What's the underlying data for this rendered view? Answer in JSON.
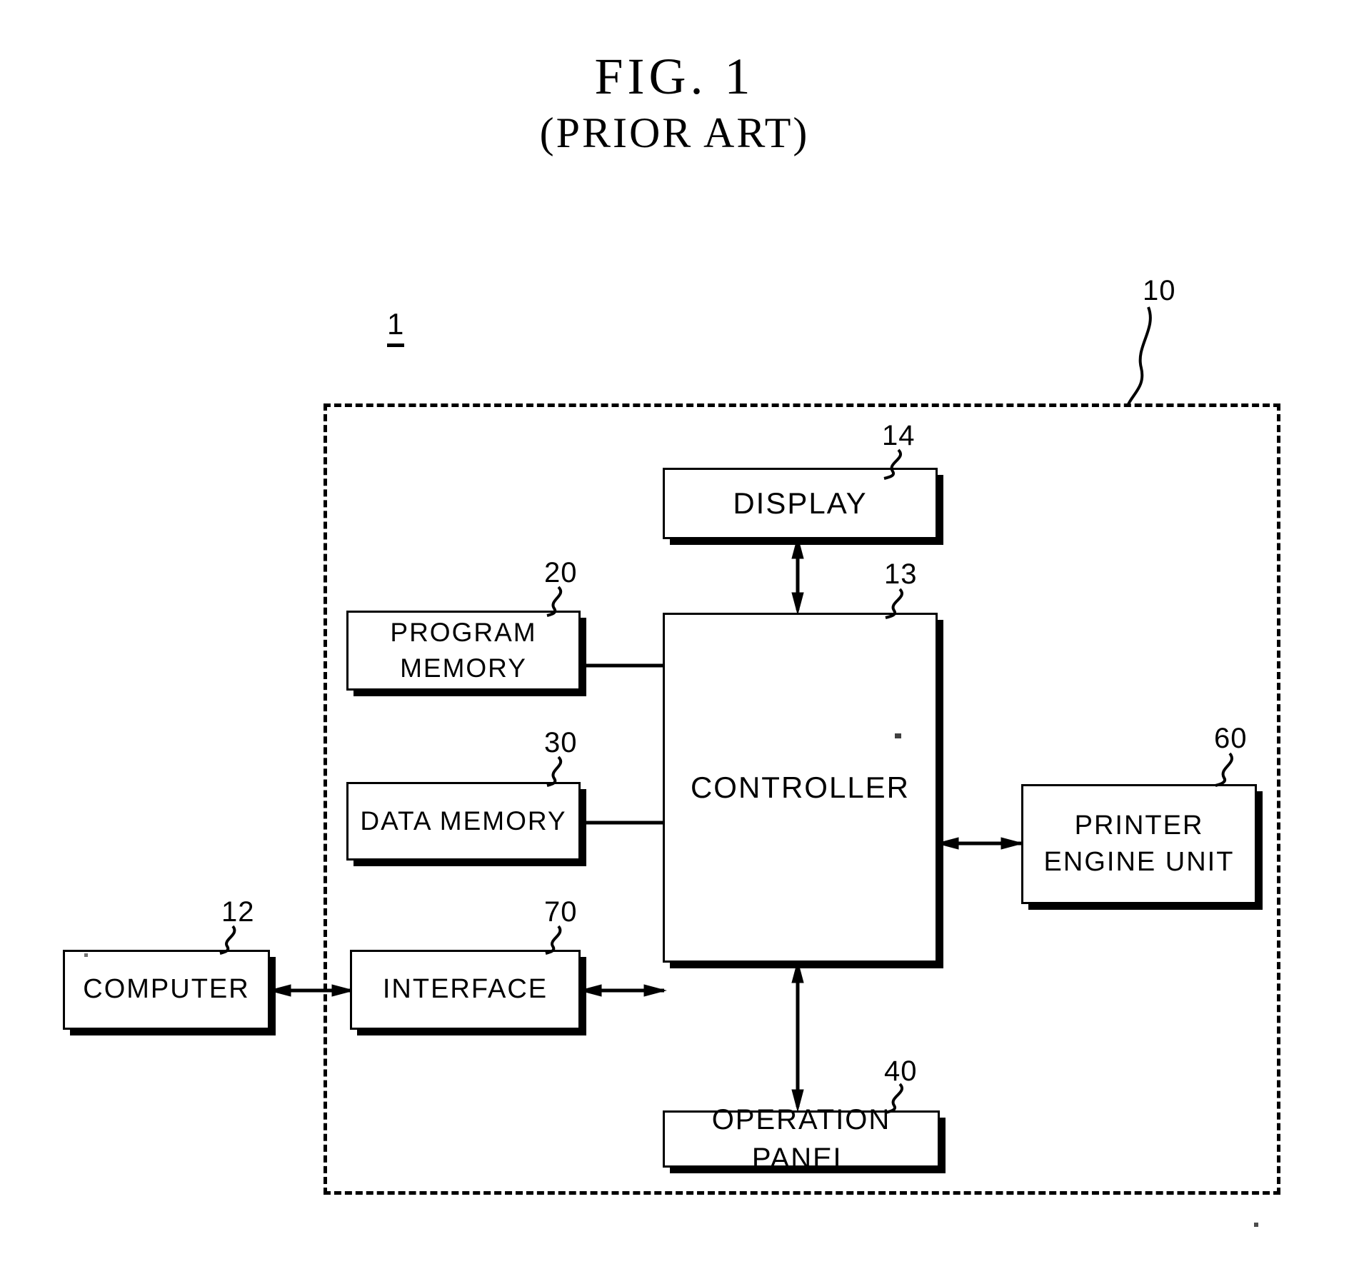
{
  "figure": {
    "title_line1": "FIG.  1",
    "title_line2": "(PRIOR ART)",
    "system_ref": "1"
  },
  "enclosure": {
    "ref": "10",
    "name": "printer-device-boundary"
  },
  "nodes": [
    {
      "id": "display",
      "label": "DISPLAY",
      "ref": "14"
    },
    {
      "id": "program_memory",
      "label": "PROGRAM\nMEMORY",
      "ref": "20"
    },
    {
      "id": "controller",
      "label": "CONTROLLER",
      "ref": "13"
    },
    {
      "id": "data_memory",
      "label": "DATA MEMORY",
      "ref": "30"
    },
    {
      "id": "printer_engine",
      "label": "PRINTER\nENGINE UNIT",
      "ref": "60"
    },
    {
      "id": "computer",
      "label": "COMPUTER",
      "ref": "12"
    },
    {
      "id": "interface",
      "label": "INTERFACE",
      "ref": "70"
    },
    {
      "id": "operation_panel",
      "label": "OPERATION PANEL",
      "ref": "40"
    }
  ],
  "connections": [
    {
      "from": "display",
      "to": "controller",
      "arrows": "both"
    },
    {
      "from": "program_memory",
      "to": "controller",
      "arrows": "none"
    },
    {
      "from": "data_memory",
      "to": "controller",
      "arrows": "none"
    },
    {
      "from": "interface",
      "to": "controller",
      "arrows": "both"
    },
    {
      "from": "computer",
      "to": "interface",
      "arrows": "both"
    },
    {
      "from": "controller",
      "to": "printer_engine",
      "arrows": "both"
    },
    {
      "from": "controller",
      "to": "operation_panel",
      "arrows": "both"
    }
  ],
  "colors": {
    "ink": "#000000",
    "paper": "#ffffff"
  }
}
